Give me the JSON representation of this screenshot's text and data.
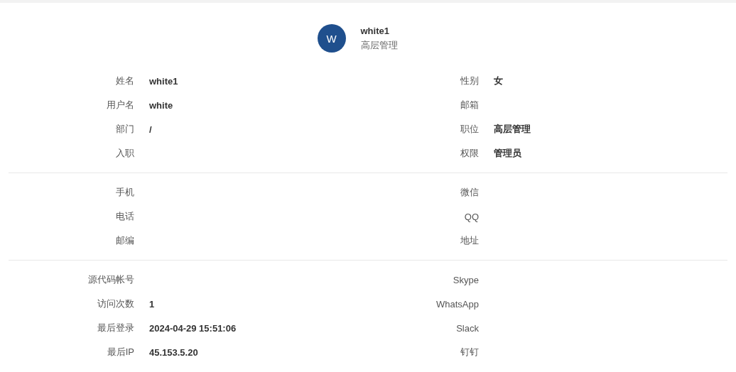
{
  "profile": {
    "avatar_letter": "W",
    "name": "white1",
    "role": "高层管理"
  },
  "sections": [
    {
      "rows": [
        {
          "left": {
            "label": "姓名",
            "value": "white1"
          },
          "right": {
            "label": "性别",
            "value": "女"
          }
        },
        {
          "left": {
            "label": "用户名",
            "value": "white"
          },
          "right": {
            "label": "邮箱"
          }
        },
        {
          "left": {
            "label": "部门",
            "value": "/"
          },
          "right": {
            "label": "职位",
            "value": "高层管理"
          }
        },
        {
          "left": {
            "label": "入职"
          },
          "right": {
            "label": "权限",
            "value": "管理员"
          }
        }
      ]
    },
    {
      "rows": [
        {
          "left": {
            "label": "手机"
          },
          "right": {
            "label": "微信"
          }
        },
        {
          "left": {
            "label": "电话"
          },
          "right": {
            "label": "QQ"
          }
        },
        {
          "left": {
            "label": "邮编"
          },
          "right": {
            "label": "地址"
          }
        }
      ]
    },
    {
      "rows": [
        {
          "left": {
            "label": "源代码帐号"
          },
          "right": {
            "label": "Skype"
          }
        },
        {
          "left": {
            "label": "访问次数",
            "value": "1"
          },
          "right": {
            "label": "WhatsApp"
          }
        },
        {
          "left": {
            "label": "最后登录",
            "value": "2024-04-29 15:51:06"
          },
          "right": {
            "label": "Slack"
          }
        },
        {
          "left": {
            "label": "最后IP",
            "value": "45.153.5.20"
          },
          "right": {
            "label": "钉钉"
          }
        }
      ]
    }
  ]
}
